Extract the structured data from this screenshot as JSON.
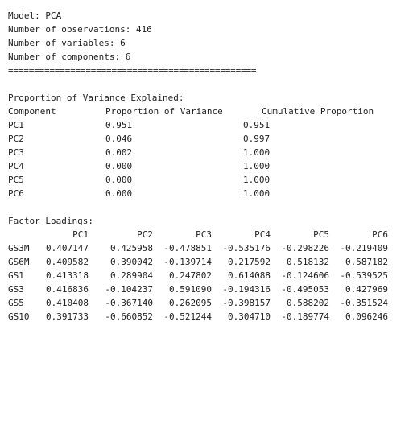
{
  "summary": {
    "model": "Model: PCA",
    "observations": "Number of observations: 416",
    "variables": "Number of variables: 6",
    "components": "Number of components: 6",
    "separator": "================================================"
  },
  "variance": {
    "heading": "Proportion of Variance Explained:",
    "headers": [
      "Component",
      "Proportion of Variance",
      "Cumulative Proportion"
    ],
    "rows": [
      {
        "component": "PC1",
        "proportion": "0.951",
        "cumulative": "0.951"
      },
      {
        "component": "PC2",
        "proportion": "0.046",
        "cumulative": "0.997"
      },
      {
        "component": "PC3",
        "proportion": "0.002",
        "cumulative": "1.000"
      },
      {
        "component": "PC4",
        "proportion": "0.000",
        "cumulative": "1.000"
      },
      {
        "component": "PC5",
        "proportion": "0.000",
        "cumulative": "1.000"
      },
      {
        "component": "PC6",
        "proportion": "0.000",
        "cumulative": "1.000"
      }
    ]
  },
  "loadings": {
    "heading": "Factor Loadings:",
    "columns": [
      "PC1",
      "PC2",
      "PC3",
      "PC4",
      "PC5",
      "PC6"
    ],
    "rows": [
      {
        "name": "GS3M",
        "values": [
          "0.407147",
          "0.425958",
          "-0.478851",
          "-0.535176",
          "-0.298226",
          "-0.219409"
        ]
      },
      {
        "name": "GS6M",
        "values": [
          "0.409582",
          "0.390042",
          "-0.139714",
          "0.217592",
          "0.518132",
          "0.587182"
        ]
      },
      {
        "name": "GS1",
        "values": [
          "0.413318",
          "0.289904",
          "0.247802",
          "0.614088",
          "-0.124606",
          "-0.539525"
        ]
      },
      {
        "name": "GS3",
        "values": [
          "0.416836",
          "-0.104237",
          "0.591090",
          "-0.194316",
          "-0.495053",
          "0.427969"
        ]
      },
      {
        "name": "GS5",
        "values": [
          "0.410408",
          "-0.367140",
          "0.262095",
          "-0.398157",
          "0.588202",
          "-0.351524"
        ]
      },
      {
        "name": "GS10",
        "values": [
          "0.391733",
          "-0.660852",
          "-0.521244",
          "0.304710",
          "-0.189774",
          "0.096246"
        ]
      }
    ]
  }
}
